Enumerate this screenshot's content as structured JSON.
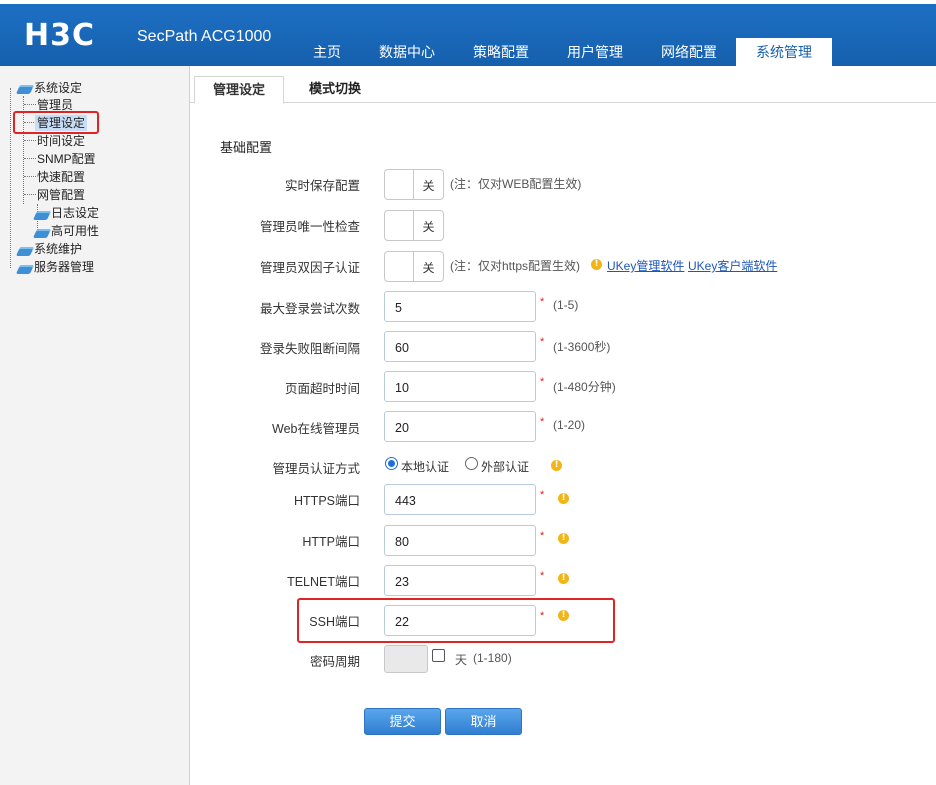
{
  "header": {
    "logo": "H3C",
    "product": "SecPath ACG1000",
    "nav": [
      "主页",
      "数据中心",
      "策略配置",
      "用户管理",
      "网络配置",
      "系统管理"
    ]
  },
  "sidebar": {
    "tree": {
      "system_settings": "系统设定",
      "admin": "管理员",
      "admin_settings": "管理设定",
      "time_settings": "时间设定",
      "snmp": "SNMP配置",
      "quick": "快速配置",
      "netmgmt": "网管配置",
      "log": "日志设定",
      "ha": "高可用性",
      "maintenance": "系统维护",
      "server": "服务器管理"
    }
  },
  "tabs": [
    "管理设定",
    "模式切换"
  ],
  "form": {
    "section_title": "基础配置",
    "realtime_save": {
      "label": "实时保存配置",
      "value": "关",
      "note": "(注：仅对WEB配置生效)"
    },
    "unique_check": {
      "label": "管理员唯一性检查",
      "value": "关"
    },
    "two_factor": {
      "label": "管理员双因子认证",
      "value": "关",
      "note": "(注：仅对https配置生效)",
      "link1": "UKey管理软件",
      "link2": "UKey客户端软件"
    },
    "max_login": {
      "label": "最大登录尝试次数",
      "value": "5",
      "req": "*",
      "hint": "(1-5)"
    },
    "block_interval": {
      "label": "登录失败阻断间隔",
      "value": "60",
      "req": "*",
      "hint": "(1-3600秒)"
    },
    "page_timeout": {
      "label": "页面超时时间",
      "value": "10",
      "req": "*",
      "hint": "(1-480分钟)"
    },
    "web_online": {
      "label": "Web在线管理员",
      "value": "20",
      "req": "*",
      "hint": "(1-20)"
    },
    "auth_mode": {
      "label": "管理员认证方式",
      "local": "本地认证",
      "external": "外部认证",
      "selected": "local"
    },
    "https_port": {
      "label": "HTTPS端口",
      "value": "443",
      "req": "*"
    },
    "http_port": {
      "label": "HTTP端口",
      "value": "80",
      "req": "*"
    },
    "telnet_port": {
      "label": "TELNET端口",
      "value": "23",
      "req": "*"
    },
    "ssh_port": {
      "label": "SSH端口",
      "value": "22",
      "req": "*"
    },
    "pwd_period": {
      "label": "密码周期",
      "unit": "天",
      "hint": "(1-180)"
    }
  },
  "buttons": {
    "submit": "提交",
    "cancel": "取消"
  },
  "colors": {
    "header": "#1660ad",
    "highlight": "#e02424",
    "info": "#f2b416"
  }
}
